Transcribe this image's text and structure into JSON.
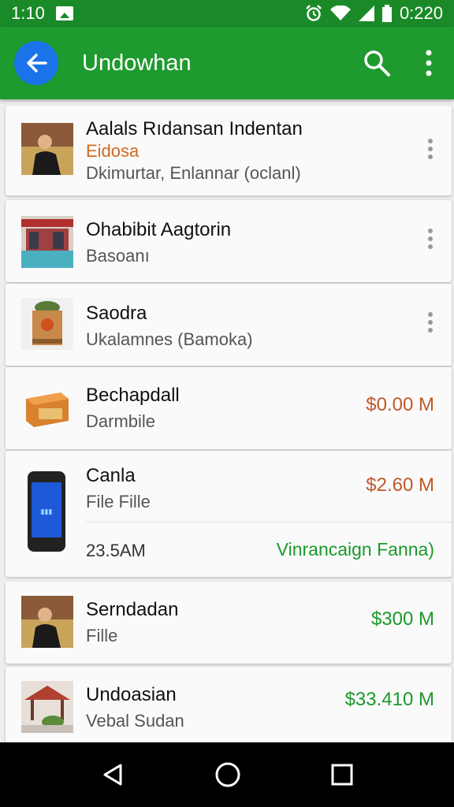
{
  "status_bar": {
    "time_left": "1:10",
    "time_right": "0:220"
  },
  "app_bar": {
    "title": "Undowhan"
  },
  "colors": {
    "primary": "#1e9a2e",
    "accent_blue": "#1a73e8",
    "price_orange": "#c0582a",
    "price_green": "#1a9a2a"
  },
  "items": [
    {
      "title": "Aalals Rıdansan Indentan",
      "subtitle": "Eidosa",
      "detail": "Dkimurtar, Enlannar (oclanl)",
      "thumb": "person-photo"
    },
    {
      "title": "Ohabibit Aagtorin",
      "subtitle": "Basoanı",
      "thumb": "storefront-photo"
    },
    {
      "title": "Saodra",
      "subtitle": "Ukalamnes (Bamoka)",
      "thumb": "box-photo"
    },
    {
      "title": "Bechapdall",
      "subtitle": "Darmbile",
      "price": "$0.00 M",
      "thumb": "package-photo"
    },
    {
      "title": "Canla",
      "subtitle": "File Fille",
      "price": "$2.60 M",
      "size": "23.5AM",
      "status": "Vinrancaign Fanna)",
      "thumb": "phone-photo"
    },
    {
      "title": "Serndadan",
      "subtitle": "Fille",
      "price": "$300 M",
      "thumb": "person-photo"
    },
    {
      "title": "Undoasian",
      "subtitle": "Vebal Sudan",
      "price": "$33.410 M",
      "thumb": "pavilion-photo"
    }
  ]
}
